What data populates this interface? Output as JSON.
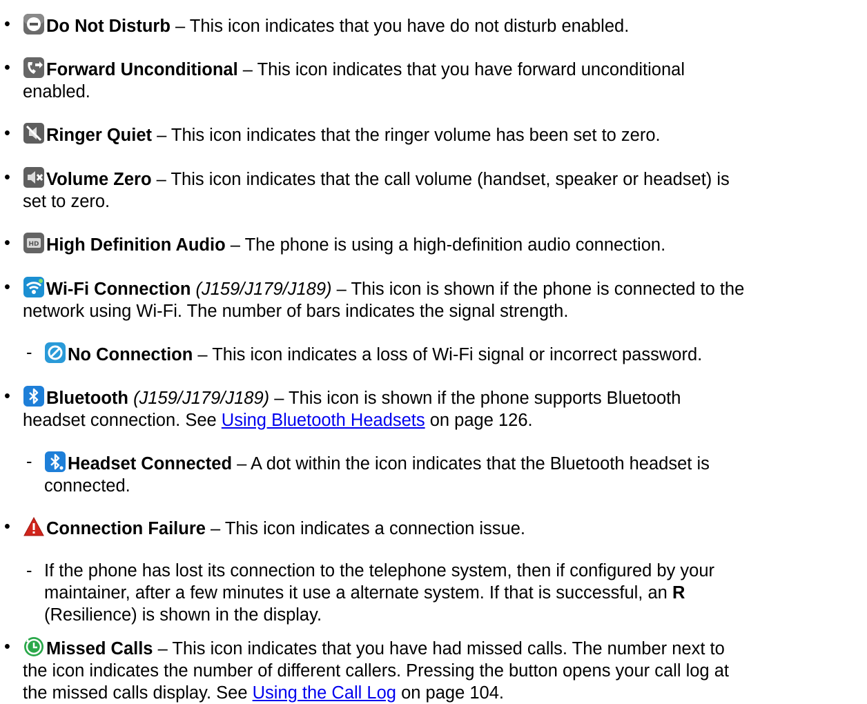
{
  "items": [
    {
      "bullet": "•",
      "icon": "do-not-disturb-icon",
      "title": "Do Not Disturb",
      "sep": " – ",
      "text": "This icon indicates that you have do not disturb enabled."
    },
    {
      "bullet": "•",
      "icon": "forward-unconditional-icon",
      "title": "Forward Unconditional",
      "sep": " – ",
      "text1": "This icon indicates that you have forward unconditional",
      "text2": "enabled."
    },
    {
      "bullet": "•",
      "icon": "ringer-quiet-icon",
      "title": "Ringer Quiet",
      "sep": " – ",
      "text": "This icon indicates that the ringer volume has been set to zero."
    },
    {
      "bullet": "•",
      "icon": "volume-zero-icon",
      "title": "Volume Zero",
      "sep": " – ",
      "text1": "This icon indicates that the call volume (handset, speaker or headset) is",
      "text2": "set to zero."
    },
    {
      "bullet": "•",
      "icon": "hd-audio-icon",
      "title": "High Definition Audio",
      "sep": " – ",
      "text": "The phone is using a high-definition audio connection."
    },
    {
      "bullet": "•",
      "icon": "wifi-icon",
      "title": "Wi-Fi Connection",
      "note": "(J159/J179/J189)",
      "sep": " – ",
      "text1": "This icon is shown if the phone is connected to the",
      "text2": "network using Wi-Fi. The number of bars indicates the signal strength."
    },
    {
      "bullet": "-",
      "icon": "no-connection-icon",
      "title": "No Connection",
      "sep": " – ",
      "text": "This icon indicates a loss of Wi-Fi signal or incorrect password."
    },
    {
      "bullet": "•",
      "icon": "bluetooth-icon",
      "title": "Bluetooth",
      "note": "(J159/J179/J189)",
      "sep": " – ",
      "text1": "This icon is shown if the phone supports Bluetooth",
      "text2_pre": "headset connection. See ",
      "link": "Using Bluetooth Headsets",
      "text2_post": " on page 126."
    },
    {
      "bullet": "-",
      "icon": "bluetooth-headset-connected-icon",
      "title": "Headset Connected",
      "sep": " – ",
      "text1": "A dot within the icon indicates that the Bluetooth headset is",
      "text2": "connected."
    },
    {
      "bullet": "•",
      "icon": "warning-icon",
      "title": "Connection Failure",
      "sep": " – ",
      "text": "This icon indicates a connection issue."
    },
    {
      "bullet": "-",
      "text1": "If the phone has lost its connection to the telephone system, then if configured by your",
      "text2": "maintainer, after a few minutes it use a alternate system. If that is successful, an",
      "bold": "R",
      "text3": "(Resilience) is shown in the display."
    },
    {
      "bullet": "•",
      "icon": "missed-calls-icon",
      "title": "Missed Calls",
      "sep": " – ",
      "text1": "This icon indicates that you have had missed calls. The number next to",
      "text2": "the icon indicates the number of different callers. Pressing the button opens your call log at",
      "text3_pre": "the missed calls display. See ",
      "link": "Using the Call Log",
      "text3_post": " on page 104."
    }
  ],
  "colors": {
    "link": "#0000ee",
    "warning": "#d0251c",
    "bluetooth": "#1e7fd8",
    "missed": "#2aa84a"
  }
}
